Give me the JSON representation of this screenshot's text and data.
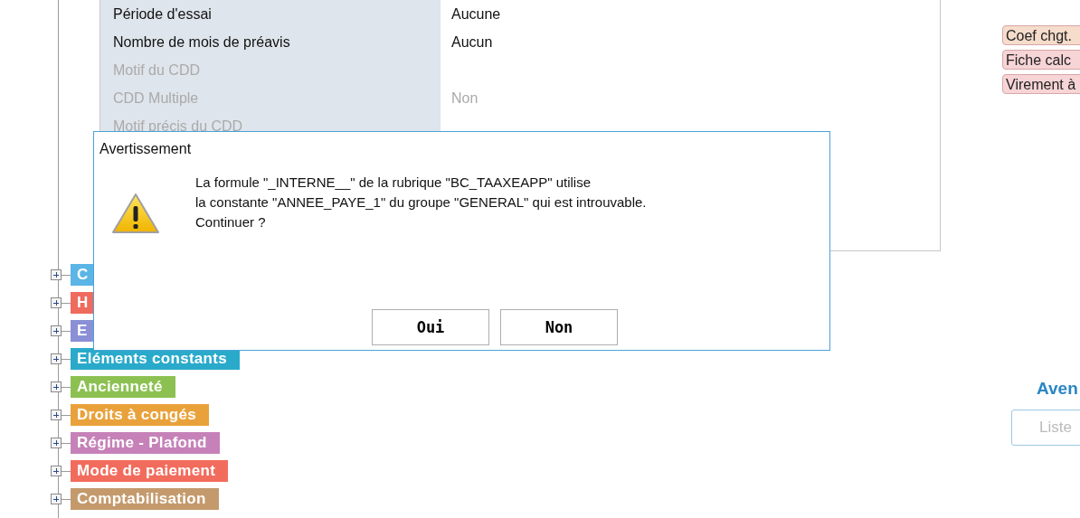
{
  "properties": [
    {
      "label": "Période d'essai",
      "value": "Aucune",
      "disabled": false
    },
    {
      "label": "Nombre de mois de préavis",
      "value": "Aucun",
      "disabled": false
    },
    {
      "label": "Motif du CDD",
      "disabled": true
    },
    {
      "label": "CDD Multiple",
      "value": "Non",
      "disabled": true
    },
    {
      "label": "Motif précis du CDD",
      "disabled": true
    }
  ],
  "tree": [
    {
      "label": "C",
      "color": "#5bb5e6",
      "expanded": false
    },
    {
      "label": "H",
      "color": "#ef6b5e",
      "expanded": false
    },
    {
      "label": "E",
      "color": "#8b8fd6",
      "expanded": false
    },
    {
      "label": "Eléments constants",
      "color": "#2aaacb",
      "expanded": false
    },
    {
      "label": "Ancienneté",
      "color": "#8cc152",
      "expanded": false
    },
    {
      "label": "Droits à congés",
      "color": "#e9a23b",
      "expanded": false
    },
    {
      "label": "Régime - Plafond",
      "color": "#c682b8",
      "expanded": false
    },
    {
      "label": "Mode de paiement",
      "color": "#f26c5d",
      "expanded": false
    },
    {
      "label": "Comptabilisation",
      "color": "#c49a6c",
      "expanded": false
    }
  ],
  "side_tags": [
    {
      "label": "Coef chgt.",
      "color": "#f6dccb"
    },
    {
      "label": "Fiche calc",
      "color": "#f7d4d6"
    },
    {
      "label": "Virement à",
      "color": "#f7d4d6"
    }
  ],
  "side_heading": "Aven",
  "side_button": {
    "label": "Liste",
    "disabled": true
  },
  "dialog": {
    "title": "Avertissement",
    "message": [
      "La formule \"_INTERNE__\" de la rubrique \"BC_TAAXEAPP\" utilise",
      "la constante \"ANNEE_PAYE_1\" du groupe \"GENERAL\" qui est introuvable.",
      "Continuer ?"
    ],
    "buttons": [
      "Oui",
      "Non"
    ]
  }
}
